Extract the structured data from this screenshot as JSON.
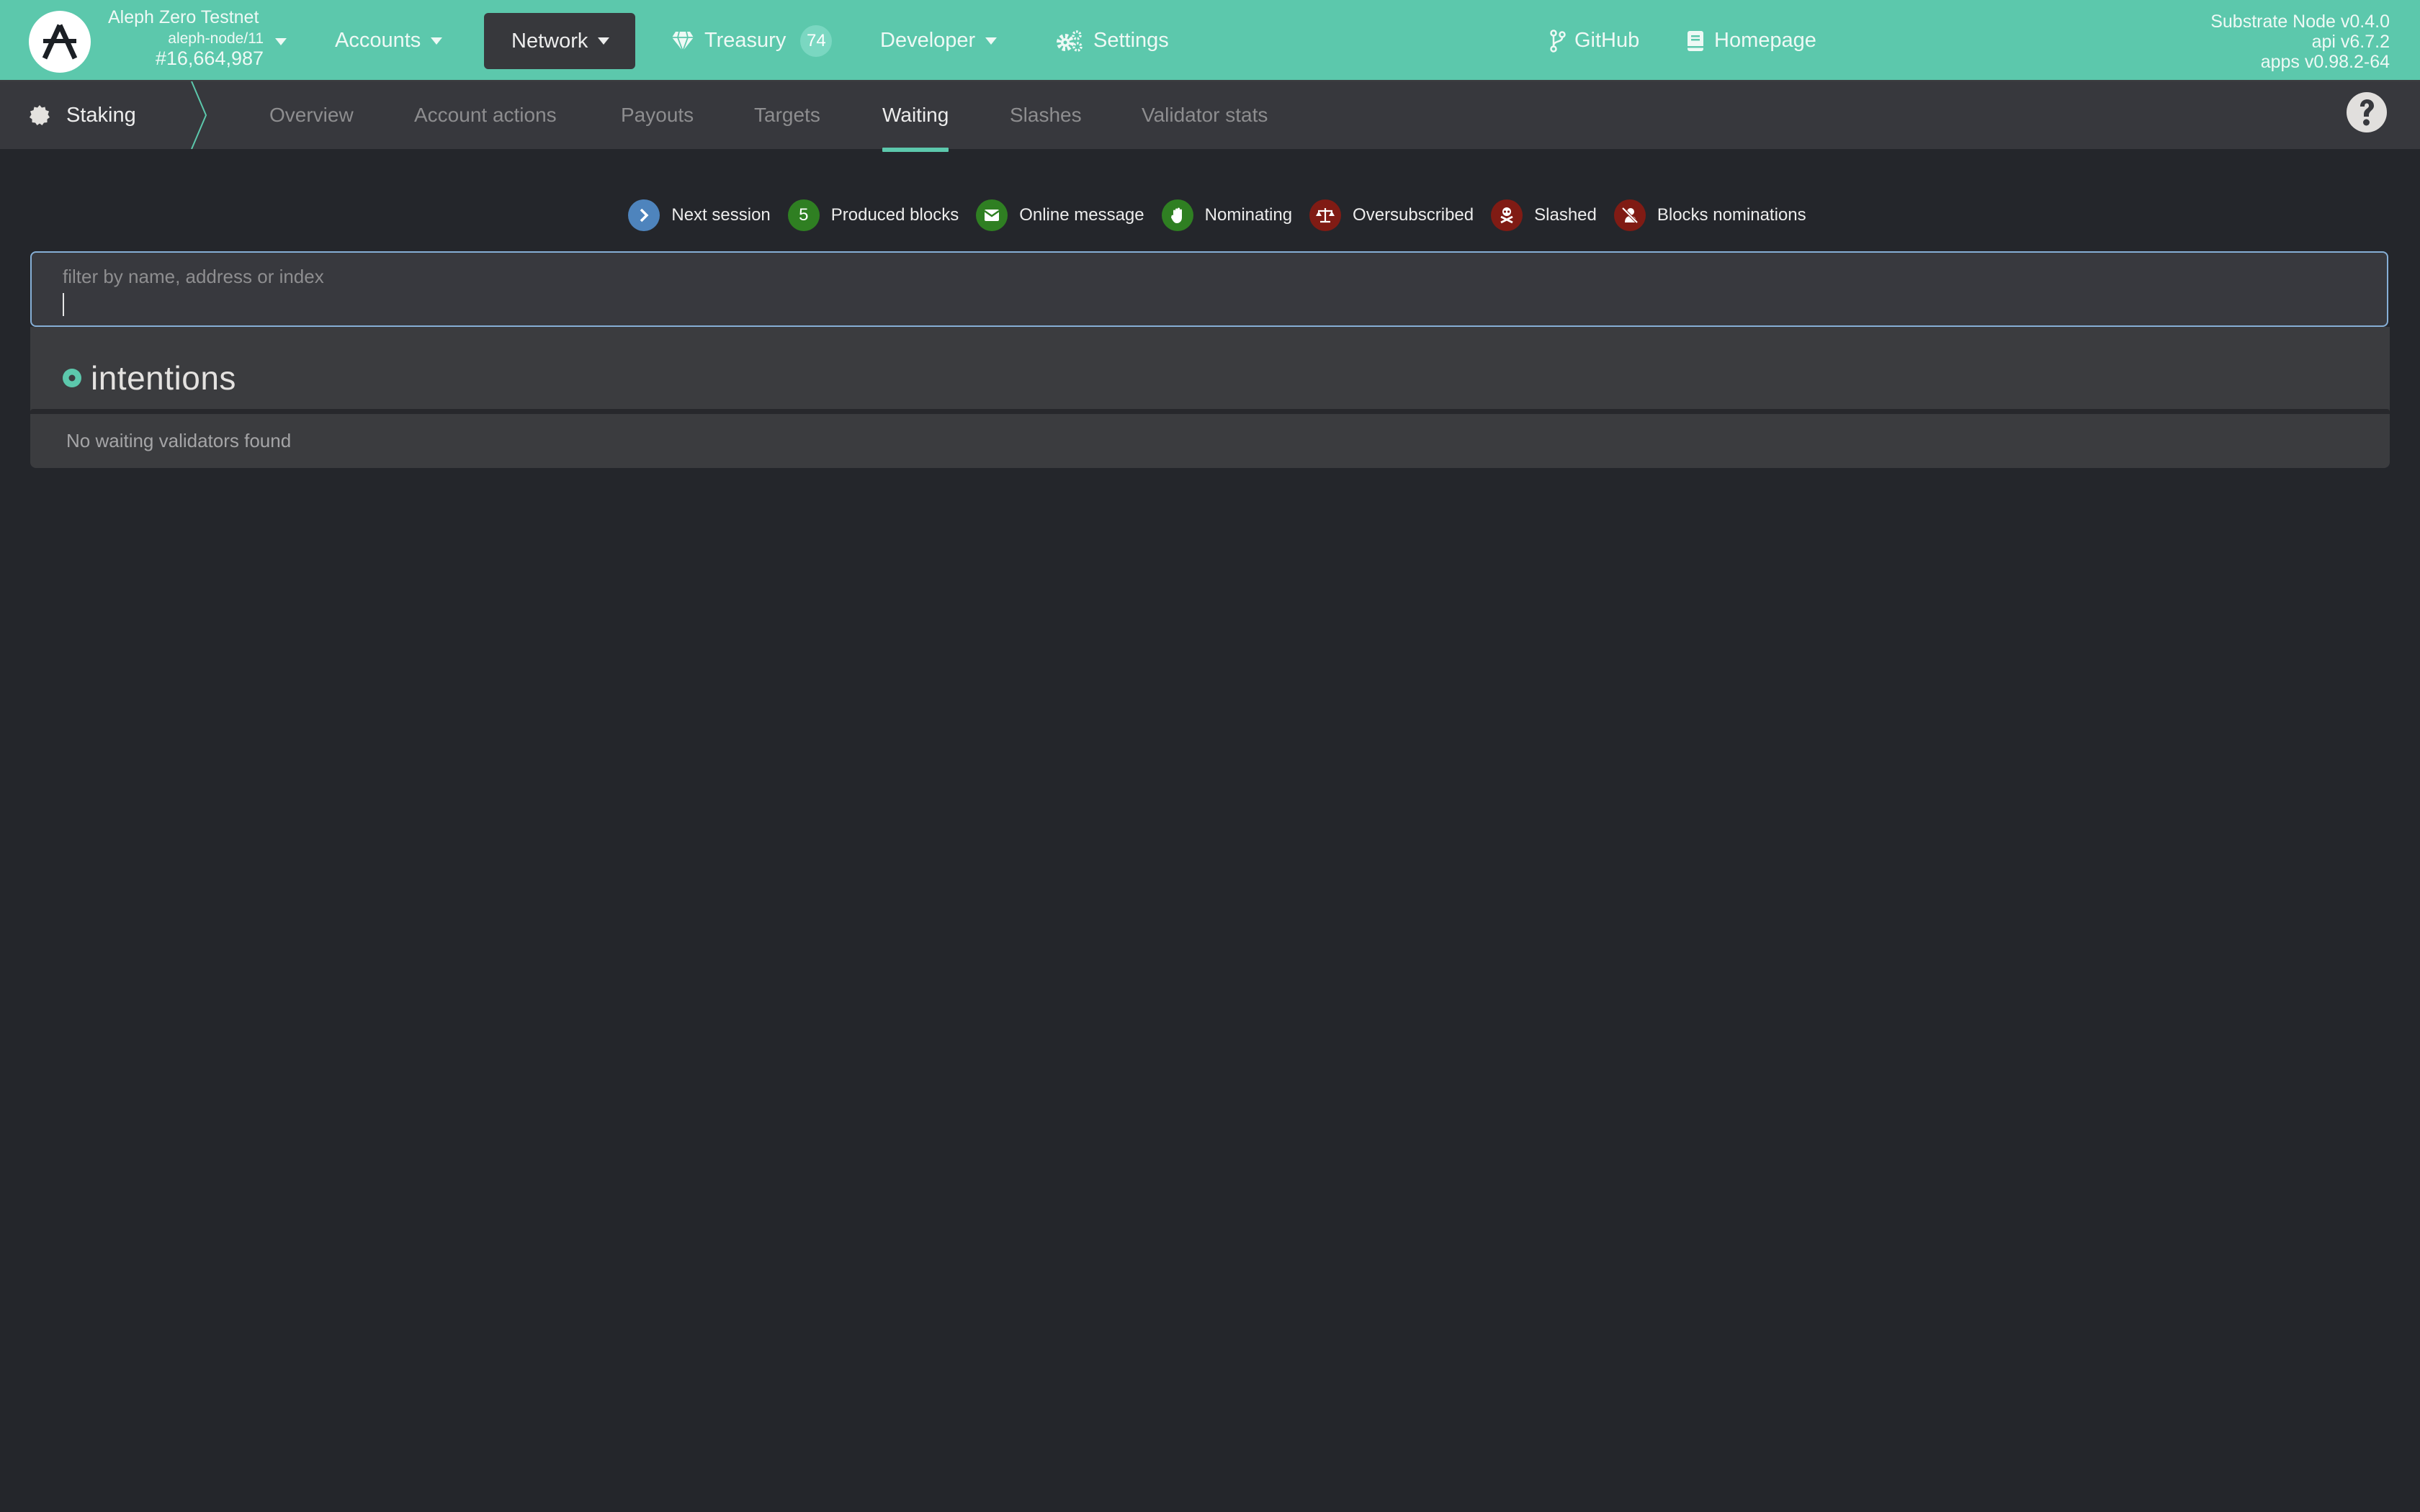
{
  "header": {
    "chain": {
      "name": "Aleph Zero Testnet",
      "node": "aleph-node/11",
      "block": "#16,664,987",
      "logo_icon": "aleph-zero-logo"
    },
    "nav": [
      {
        "label": "Accounts",
        "icon": "caret-down-icon",
        "active": false
      },
      {
        "label": "Network",
        "icon": "caret-down-icon",
        "active": true
      },
      {
        "label": "Treasury",
        "icon": "diamond-icon",
        "badge": "74",
        "active": false
      },
      {
        "label": "Developer",
        "icon": "caret-down-icon",
        "active": false
      },
      {
        "label": "Settings",
        "icon": "gears-icon",
        "active": false
      }
    ],
    "links": [
      {
        "label": "GitHub",
        "icon": "code-branch-icon"
      },
      {
        "label": "Homepage",
        "icon": "book-icon"
      }
    ],
    "versions": [
      "Substrate Node v0.4.0",
      "api v6.7.2",
      "apps v0.98.2-64"
    ]
  },
  "subnav": {
    "section": {
      "label": "Staking",
      "icon": "certificate-icon"
    },
    "tabs": [
      {
        "label": "Overview",
        "active": false
      },
      {
        "label": "Account actions",
        "active": false
      },
      {
        "label": "Payouts",
        "active": false
      },
      {
        "label": "Targets",
        "active": false
      },
      {
        "label": "Waiting",
        "active": true
      },
      {
        "label": "Slashes",
        "active": false
      },
      {
        "label": "Validator stats",
        "active": false
      }
    ],
    "help_icon": "question-circle-icon"
  },
  "legend": [
    {
      "label": "Next session",
      "icon": "chevron-right-icon",
      "glyph": "›",
      "color": "#4e84bd"
    },
    {
      "label": "Produced blocks",
      "icon": "count-icon",
      "glyph": "5",
      "color": "#2f7f22"
    },
    {
      "label": "Online message",
      "icon": "envelope-icon",
      "glyph": "",
      "color": "#2f7f22"
    },
    {
      "label": "Nominating",
      "icon": "hand-paper-icon",
      "glyph": "",
      "color": "#2f7f22"
    },
    {
      "label": "Oversubscribed",
      "icon": "balance-scale-icon",
      "glyph": "",
      "color": "#801b14"
    },
    {
      "label": "Slashed",
      "icon": "skull-crossbones-icon",
      "glyph": "",
      "color": "#801b14"
    },
    {
      "label": "Blocks nominations",
      "icon": "user-slash-icon",
      "glyph": "",
      "color": "#801b14"
    }
  ],
  "filter": {
    "label": "filter by name, address or index",
    "value": ""
  },
  "table": {
    "title": "intentions",
    "empty_message": "No waiting validators found"
  },
  "colors": {
    "accent": "#5cc8ac",
    "background": "#24262b",
    "panel": "#37383d",
    "focus_border": "#86afd6"
  }
}
